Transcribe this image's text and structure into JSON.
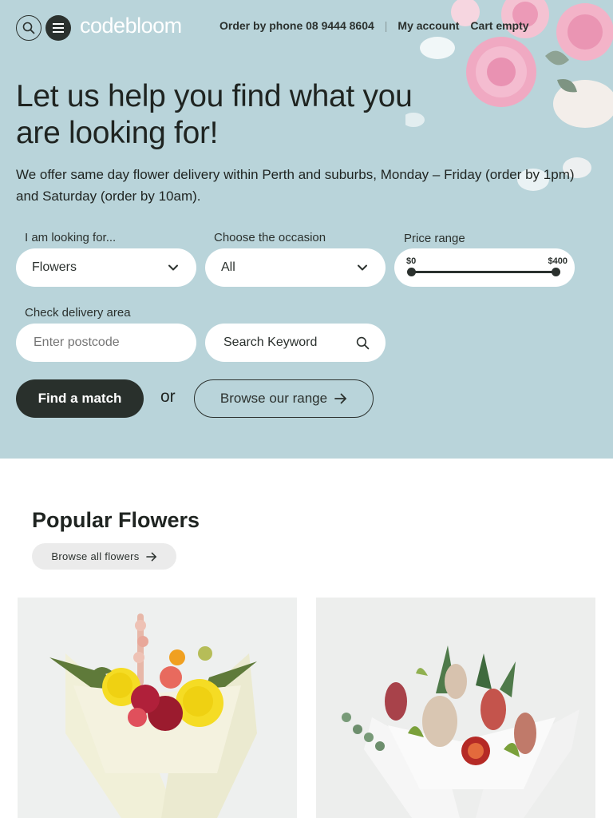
{
  "header": {
    "logo_part1": "code",
    "logo_part2": "bloom",
    "phone_text": "Order by phone 08 9444 8604",
    "separator": "|",
    "account": "My account",
    "cart": "Cart empty"
  },
  "hero": {
    "title": "Let us help you find what you are looking for!",
    "intro": "We offer same day flower delivery within Perth and suburbs, Monday – Friday (order by 1pm) and Saturday (order by 10am)."
  },
  "form": {
    "looking_label": "I am looking for...",
    "looking_value": "Flowers",
    "occasion_label": "Choose the occasion",
    "occasion_value": "All",
    "price_label": "Price range",
    "price_min": "$0",
    "price_max": "$400",
    "price_range_selected": [
      0,
      400
    ],
    "delivery_label": "Check delivery area",
    "postcode_placeholder": "Enter postcode",
    "keyword_placeholder": "Search Keyword",
    "find_button": "Find a match",
    "or_text": "or",
    "browse_button": "Browse our range"
  },
  "popular": {
    "title": "Popular Flowers",
    "browse_all": "Browse all flowers"
  },
  "colors": {
    "hero_bg": "#b9d4da",
    "dark": "#29302c",
    "pill_bg": "#ebebeb"
  }
}
